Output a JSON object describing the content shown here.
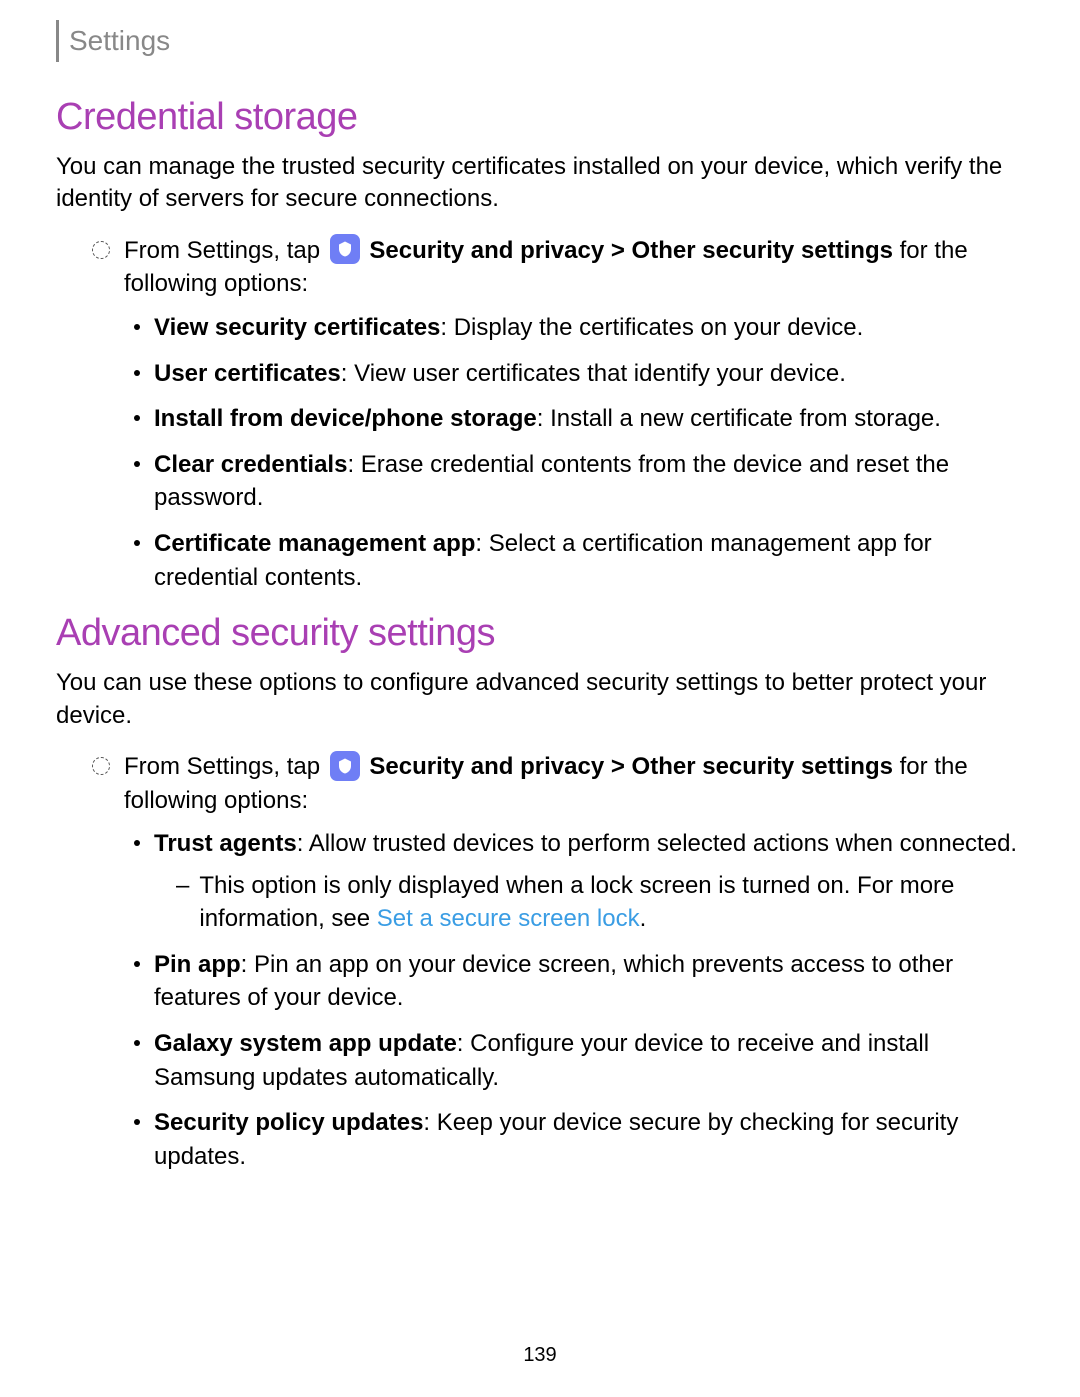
{
  "header": {
    "title": "Settings"
  },
  "section1": {
    "heading": "Credential storage",
    "intro": "You can manage the trusted security certificates installed on your device, which verify the identity of servers for secure connections.",
    "step_prefix": "From Settings, tap",
    "step_bold": "Security and privacy > Other security settings",
    "step_suffix": " for the following options:",
    "bullets": [
      {
        "bold": "View security certificates",
        "text": ": Display the certificates on your device."
      },
      {
        "bold": "User certificates",
        "text": ": View user certificates that identify your device."
      },
      {
        "bold": "Install from device/phone storage",
        "text": ": Install a new certificate from storage."
      },
      {
        "bold": "Clear credentials",
        "text": ": Erase credential contents from the device and reset the password."
      },
      {
        "bold": "Certificate management app",
        "text": ": Select a certification management app for credential contents."
      }
    ]
  },
  "section2": {
    "heading": "Advanced security settings",
    "intro": "You can use these options to configure advanced security settings to better protect your device.",
    "step_prefix": "From Settings, tap",
    "step_bold": "Security and privacy > Other security settings",
    "step_suffix": " for the following options:",
    "bullets": [
      {
        "bold": "Trust agents",
        "text": ": Allow trusted devices to perform selected actions when connected.",
        "sub_prefix": "This option is only displayed when a lock screen is turned on. For more information, see ",
        "sub_link": "Set a secure screen lock",
        "sub_suffix": "."
      },
      {
        "bold": "Pin app",
        "text": ": Pin an app on your device screen, which prevents access to other features of your device."
      },
      {
        "bold": "Galaxy system app update",
        "text": ": Configure your device to receive and install Samsung updates automatically."
      },
      {
        "bold": "Security policy updates",
        "text": ": Keep your device secure by checking for security updates."
      }
    ]
  },
  "page_number": "139"
}
